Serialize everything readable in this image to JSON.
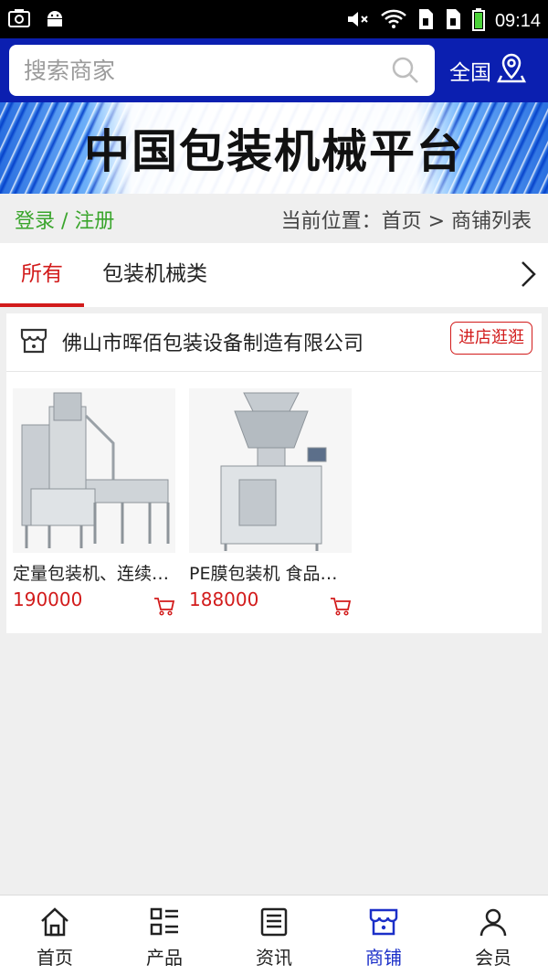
{
  "status_bar": {
    "time": "09:14"
  },
  "search": {
    "placeholder": "搜索商家",
    "region_label": "全国"
  },
  "banner": {
    "title": "中国包装机械平台"
  },
  "auth": {
    "login": "登录",
    "separator": " / ",
    "register": "注册"
  },
  "breadcrumb": {
    "text": "当前位置：首页 > 商铺列表"
  },
  "tabs": [
    {
      "label": "所有",
      "active": true
    },
    {
      "label": "包装机械类",
      "active": false
    }
  ],
  "shop": {
    "name": "佛山市晖佰包装设备制造有限公司",
    "visit_label": "进店逛逛",
    "products": [
      {
        "name": "定量包装机、连续包装机",
        "price": "190000"
      },
      {
        "name": "PE膜包装机 食品包装机",
        "price": "188000"
      }
    ]
  },
  "bottom_nav": [
    {
      "label": "首页",
      "icon": "home-icon"
    },
    {
      "label": "产品",
      "icon": "product-list-icon"
    },
    {
      "label": "资讯",
      "icon": "news-icon"
    },
    {
      "label": "商铺",
      "icon": "shop-icon",
      "active": true
    },
    {
      "label": "会员",
      "icon": "member-icon"
    }
  ],
  "colors": {
    "header": "#0b1fb0",
    "accent": "#d21b1b",
    "login": "#3aa52c",
    "nav_active": "#1b2fc8"
  }
}
